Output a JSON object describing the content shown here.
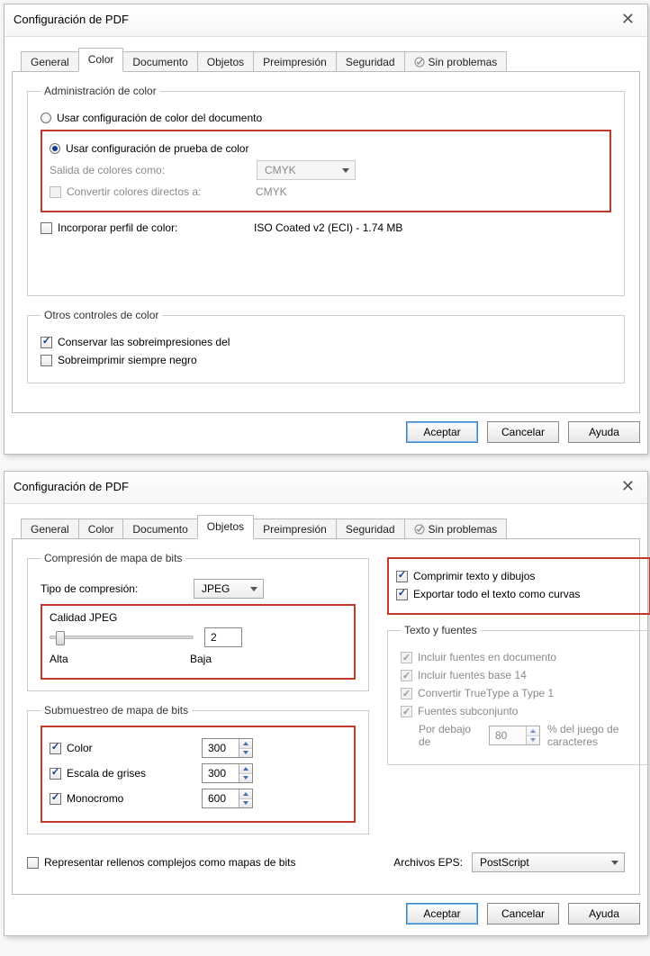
{
  "dialog1": {
    "title": "Configuración de PDF",
    "tabs": [
      "General",
      "Color",
      "Documento",
      "Objetos",
      "Preimpresión",
      "Seguridad",
      "Sin problemas"
    ],
    "active_tab": 1,
    "color_admin": {
      "legend": "Administración de color",
      "radio_doc": "Usar configuración de color del documento",
      "radio_proof": "Usar configuración de prueba de color",
      "output_label": "Salida de colores como:",
      "output_value": "CMYK",
      "convert_spot_label": "Convertir colores directos a:",
      "convert_spot_value": "CMYK",
      "embed_profile_label": "Incorporar perfil de color:",
      "embed_profile_value": "ISO Coated v2 (ECI) - 1.74 MB"
    },
    "other": {
      "legend": "Otros controles de color",
      "overprint": "Conservar las sobreimpresiones del",
      "black": "Sobreimprimir siempre negro"
    },
    "buttons": {
      "ok": "Aceptar",
      "cancel": "Cancelar",
      "help": "Ayuda"
    }
  },
  "dialog2": {
    "title": "Configuración de PDF",
    "tabs": [
      "General",
      "Color",
      "Documento",
      "Objetos",
      "Preimpresión",
      "Seguridad",
      "Sin problemas"
    ],
    "active_tab": 3,
    "bitmap_comp": {
      "legend": "Compresión de mapa de bits",
      "type_label": "Tipo de compresión:",
      "type_value": "JPEG",
      "jpeg_quality_label": "Calidad JPEG",
      "quality_value": "2",
      "high": "Alta",
      "low": "Baja"
    },
    "subsample": {
      "legend": "Submuestreo de mapa de bits",
      "color": "Color",
      "color_value": "300",
      "gray": "Escala de grises",
      "gray_value": "300",
      "mono": "Monocromo",
      "mono_value": "600"
    },
    "complex_fills": "Representar rellenos complejos como mapas de bits",
    "compress_text": "Comprimir texto y dibujos",
    "text_as_curves": "Exportar todo el texto como curvas",
    "text_fonts": {
      "legend": "Texto y fuentes",
      "include": "Incluir fuentes en documento",
      "base14": "Incluir fuentes base 14",
      "tt2t1": "Convertir TrueType a Type 1",
      "subset": "Fuentes subconjunto",
      "below_label1": "Por debajo de",
      "below_value": "80",
      "below_label2": "% del juego de caracteres"
    },
    "eps_label": "Archivos EPS:",
    "eps_value": "PostScript",
    "buttons": {
      "ok": "Aceptar",
      "cancel": "Cancelar",
      "help": "Ayuda"
    }
  }
}
